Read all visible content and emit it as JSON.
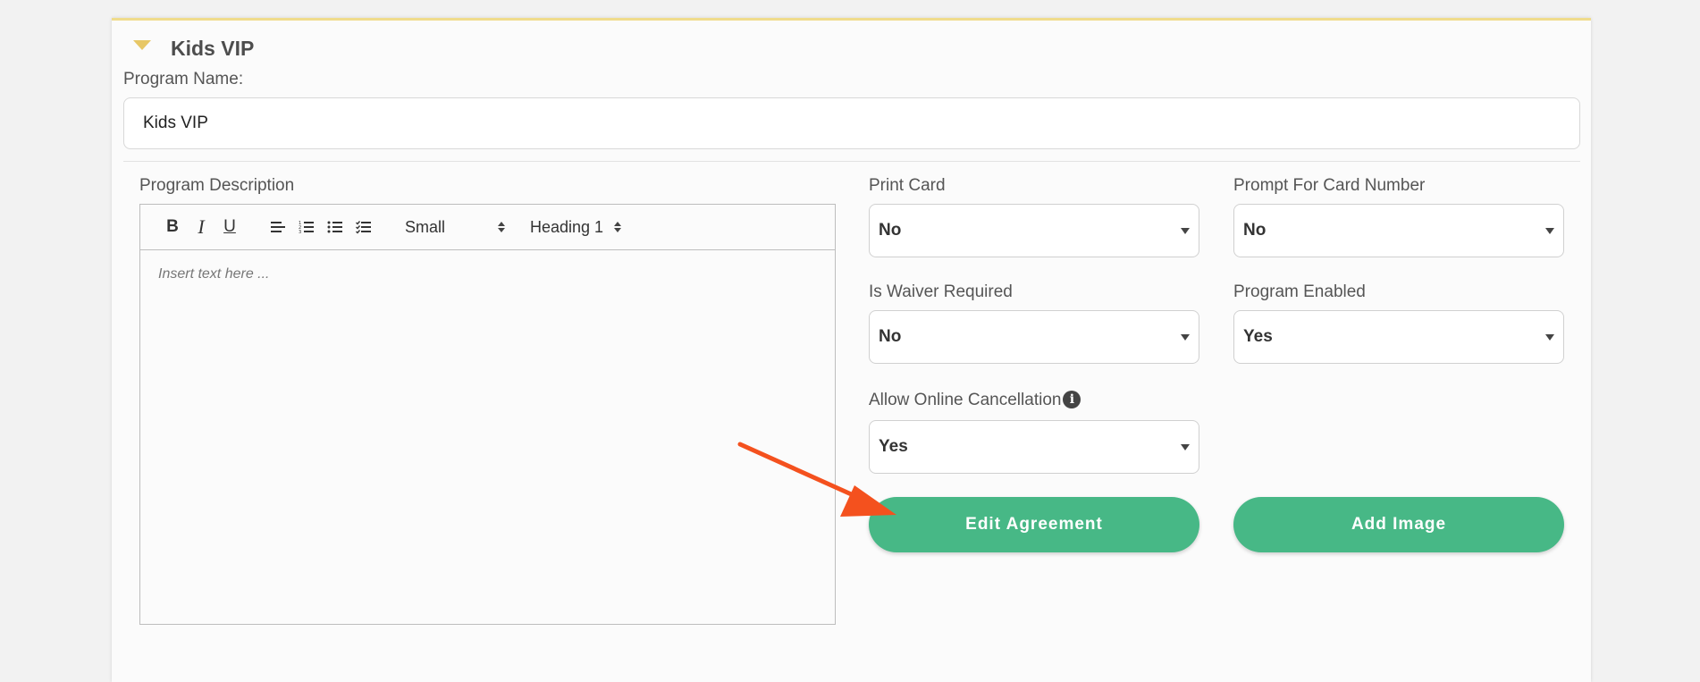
{
  "program": {
    "title": "Kids VIP",
    "name_label": "Program Name:",
    "name_value": "Kids VIP"
  },
  "description": {
    "label": "Program Description",
    "toolbar": {
      "bold": "B",
      "italic": "I",
      "underline": "U",
      "size": "Small",
      "heading": "Heading 1"
    },
    "placeholder": "Insert text here ..."
  },
  "fields": {
    "print_card": {
      "label": "Print Card",
      "value": "No"
    },
    "prompt_card_number": {
      "label": "Prompt For Card Number",
      "value": "No"
    },
    "waiver_required": {
      "label": "Is Waiver Required",
      "value": "No"
    },
    "program_enabled": {
      "label": "Program Enabled",
      "value": "Yes"
    },
    "online_cancellation": {
      "label": "Allow Online Cancellation",
      "value": "Yes",
      "info_icon": "i"
    }
  },
  "buttons": {
    "edit_agreement": "Edit Agreement",
    "add_image": "Add Image"
  },
  "colors": {
    "accent_green": "#47b886",
    "arrow": "#f4511e",
    "header_border": "#f0dc8c"
  }
}
